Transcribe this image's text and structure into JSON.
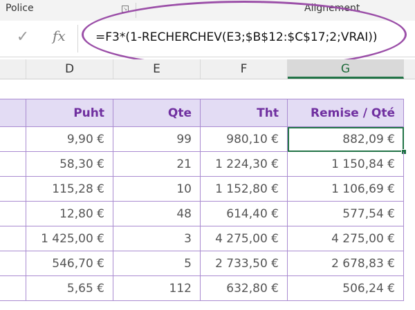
{
  "ribbon": {
    "police_label": "Police",
    "alignement_label": "Alignement",
    "launcher_glyph": "↘"
  },
  "formula_bar": {
    "confirm_glyph": "✓",
    "fx_label": "fx",
    "formula": "=F3*(1-RECHERCHEV(E3;$B$12:$C$17;2;VRAI))"
  },
  "columns": [
    "D",
    "E",
    "F",
    "G"
  ],
  "table": {
    "headers": [
      "Puht",
      "Qte",
      "Tht",
      "Remise / Qté"
    ],
    "rows": [
      [
        "9,90 €",
        "99",
        "980,10 €",
        "882,09 €"
      ],
      [
        "58,30 €",
        "21",
        "1 224,30 €",
        "1 150,84 €"
      ],
      [
        "115,28 €",
        "10",
        "1 152,80 €",
        "1 106,69 €"
      ],
      [
        "12,80 €",
        "48",
        "614,40 €",
        "577,54 €"
      ],
      [
        "1 425,00 €",
        "3",
        "4 275,00 €",
        "4 275,00 €"
      ],
      [
        "546,70 €",
        "5",
        "2 733,50 €",
        "2 678,83 €"
      ],
      [
        "5,65 €",
        "112",
        "632,80 €",
        "506,24 €"
      ]
    ]
  },
  "colors": {
    "accent_purple": "#7030a0",
    "header_fill": "#e3dcf4",
    "grid_border": "#a98ad0",
    "selection_green": "#217346",
    "annotation_ellipse": "#9b4fa8"
  }
}
